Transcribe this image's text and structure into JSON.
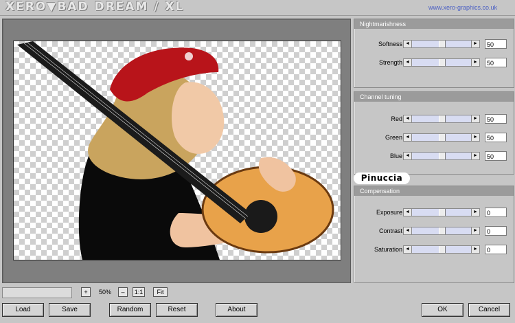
{
  "app": {
    "title": "XERO▼BAD DREAM / XL",
    "url": "www.xero-graphics.co.uk"
  },
  "groups": {
    "nightmarishness": {
      "title": "Nightmarishness",
      "rows": [
        {
          "label": "Softness",
          "value": "50",
          "level": 0.5
        },
        {
          "label": "Strength",
          "value": "50",
          "level": 0.5
        }
      ]
    },
    "channel": {
      "title": "Channel tuning",
      "rows": [
        {
          "label": "Red",
          "value": "50",
          "level": 0.5
        },
        {
          "label": "Green",
          "value": "50",
          "level": 0.5
        },
        {
          "label": "Blue",
          "value": "50",
          "level": 0.5
        }
      ]
    },
    "compensation": {
      "title": "Compensation",
      "rows": [
        {
          "label": "Exposure",
          "value": "0",
          "level": 0.5
        },
        {
          "label": "Contrast",
          "value": "0",
          "level": 0.5
        },
        {
          "label": "Saturation",
          "value": "0",
          "level": 0.5
        }
      ]
    }
  },
  "badge": "Pinuccia",
  "zoom": {
    "plus": "+",
    "value": "50%",
    "minus": "–",
    "one_to_one": "1:1",
    "fit": "Fit"
  },
  "buttons": {
    "load": "Load",
    "save": "Save",
    "random": "Random",
    "reset": "Reset",
    "about": "About",
    "ok": "OK",
    "cancel": "Cancel"
  },
  "icons": {
    "left_arrow": "left-arrow-icon",
    "right_arrow": "right-arrow-icon"
  },
  "colors": {
    "slider_track": "#d8dcf2",
    "header": "#9b9b9b",
    "hat": "#b8141a",
    "guitar": "#e8a24a"
  }
}
